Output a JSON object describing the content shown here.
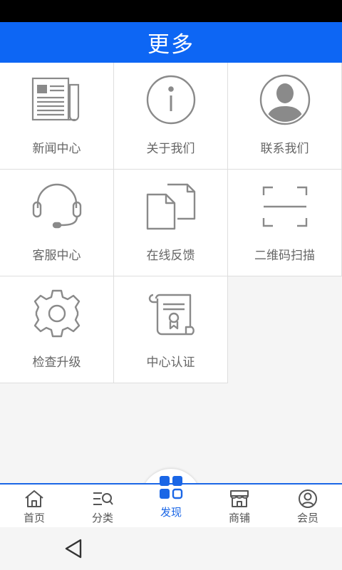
{
  "header": {
    "title": "更多"
  },
  "grid": {
    "items": [
      {
        "label": "新闻中心",
        "icon": "newspaper-icon"
      },
      {
        "label": "关于我们",
        "icon": "info-icon"
      },
      {
        "label": "联系我们",
        "icon": "contact-person-icon"
      },
      {
        "label": "客服中心",
        "icon": "headset-icon"
      },
      {
        "label": "在线反馈",
        "icon": "documents-icon"
      },
      {
        "label": "二维码扫描",
        "icon": "scan-frame-icon"
      },
      {
        "label": "检查升级",
        "icon": "gear-icon"
      },
      {
        "label": "中心认证",
        "icon": "certificate-scroll-icon"
      }
    ]
  },
  "tabbar": {
    "tabs": [
      {
        "label": "首页",
        "icon": "home-icon"
      },
      {
        "label": "分类",
        "icon": "category-search-icon"
      },
      {
        "label": "发现",
        "icon": "discover-grid-icon",
        "active": true
      },
      {
        "label": "商铺",
        "icon": "shop-icon"
      },
      {
        "label": "会员",
        "icon": "member-icon"
      }
    ]
  },
  "colors": {
    "primary": "#0d66f4",
    "icon_gray": "#8a8a8a",
    "active_tab": "#1a66e6"
  }
}
